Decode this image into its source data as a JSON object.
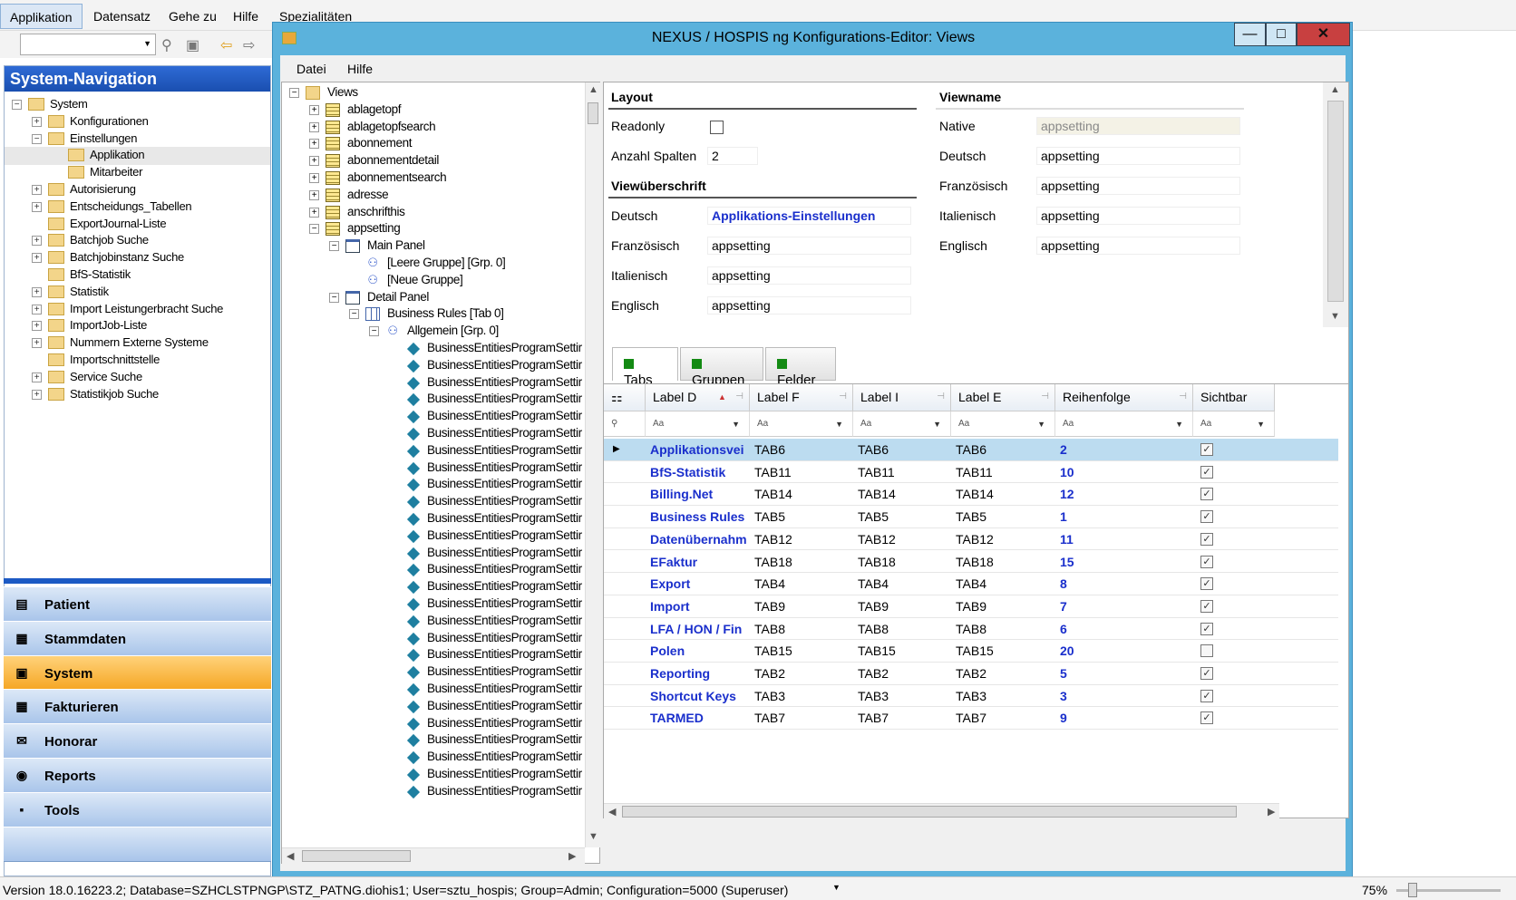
{
  "app": {
    "menu": [
      "Applikation",
      "Datensatz",
      "Gehe zu",
      "Hilfe",
      "Spezialitäten"
    ]
  },
  "sysnav": {
    "title": "System-Navigation",
    "items": [
      {
        "label": "System",
        "level": 0,
        "exp": "−"
      },
      {
        "label": "Konfigurationen",
        "level": 1,
        "exp": "+"
      },
      {
        "label": "Einstellungen",
        "level": 1,
        "exp": "−"
      },
      {
        "label": "Applikation",
        "level": 2,
        "exp": "",
        "selected": true
      },
      {
        "label": "Mitarbeiter",
        "level": 2,
        "exp": ""
      },
      {
        "label": "Autorisierung",
        "level": 1,
        "exp": "+"
      },
      {
        "label": "Entscheidungs_Tabellen",
        "level": 1,
        "exp": "+"
      },
      {
        "label": "ExportJournal-Liste",
        "level": 1,
        "exp": ""
      },
      {
        "label": "Batchjob Suche",
        "level": 1,
        "exp": "+"
      },
      {
        "label": "Batchjobinstanz Suche",
        "level": 1,
        "exp": "+"
      },
      {
        "label": "BfS-Statistik",
        "level": 1,
        "exp": ""
      },
      {
        "label": "Statistik",
        "level": 1,
        "exp": "+"
      },
      {
        "label": "Import Leistungerbracht Suche",
        "level": 1,
        "exp": "+"
      },
      {
        "label": "ImportJob-Liste",
        "level": 1,
        "exp": "+"
      },
      {
        "label": "Nummern Externe Systeme",
        "level": 1,
        "exp": "+"
      },
      {
        "label": "Importschnittstelle",
        "level": 1,
        "exp": ""
      },
      {
        "label": "Service Suche",
        "level": 1,
        "exp": "+"
      },
      {
        "label": "Statistikjob Suche",
        "level": 1,
        "exp": "+"
      }
    ],
    "buttons": [
      {
        "label": "Patient",
        "icon": "patient-icon",
        "glyph": "▤"
      },
      {
        "label": "Stammdaten",
        "icon": "stammdaten-icon",
        "glyph": "▦"
      },
      {
        "label": "System",
        "icon": "system-icon",
        "glyph": "▣",
        "active": true
      },
      {
        "label": "Fakturieren",
        "icon": "fakturieren-icon",
        "glyph": "▦"
      },
      {
        "label": "Honorar",
        "icon": "honorar-icon",
        "glyph": "✉"
      },
      {
        "label": "Reports",
        "icon": "reports-icon",
        "glyph": "◉"
      },
      {
        "label": "Tools",
        "icon": "tools-icon",
        "glyph": "▪"
      }
    ]
  },
  "editor": {
    "title": "NEXUS / HOSPIS ng Konfigurations-Editor: Views",
    "menu": [
      "Datei",
      "Hilfe"
    ],
    "tree": {
      "root": "Views",
      "views": [
        "ablagetopf",
        "ablagetopfsearch",
        "abonnement",
        "abonnementdetail",
        "abonnementsearch",
        "adresse",
        "anschrifthis",
        "appsetting"
      ],
      "main_panel": "Main Panel",
      "main_groups": [
        "[Leere Gruppe] [Grp. 0]",
        "[Neue Gruppe]"
      ],
      "detail_panel": "Detail Panel",
      "business_rules": "Business Rules [Tab 0]",
      "allgemein": "Allgemein [Grp. 0]",
      "leaf": "BusinessEntitiesProgramSettir",
      "leaf_count": 27
    },
    "layout": {
      "section": "Layout",
      "readonly_label": "Readonly",
      "spalten_label": "Anzahl Spalten",
      "spalten_value": "2"
    },
    "ueberschrift": {
      "section": "Viewüberschrift",
      "deutsch_label": "Deutsch",
      "deutsch_value": "Applikations-Einstellungen",
      "franz_label": "Französisch",
      "franz_value": "appsetting",
      "ital_label": "Italienisch",
      "ital_value": "appsetting",
      "engl_label": "Englisch",
      "engl_value": "appsetting"
    },
    "viewname": {
      "section": "Viewname",
      "native_label": "Native",
      "native_value": "appsetting",
      "deutsch_label": "Deutsch",
      "deutsch_value": "appsetting",
      "franz_label": "Französisch",
      "franz_value": "appsetting",
      "ital_label": "Italienisch",
      "ital_value": "appsetting",
      "engl_label": "Englisch",
      "engl_value": "appsetting"
    },
    "tabs": [
      "Tabs",
      "Gruppen",
      "Felder"
    ],
    "grid": {
      "columns": [
        "Label D",
        "Label F",
        "Label I",
        "Label E",
        "Reihenfolge",
        "Sichtbar"
      ],
      "filter_glyph": "Aa",
      "rows": [
        {
          "d": "Applikationsvei",
          "f": "TAB6",
          "i": "TAB6",
          "e": "TAB6",
          "r": "2",
          "v": true
        },
        {
          "d": "BfS-Statistik",
          "f": "TAB11",
          "i": "TAB11",
          "e": "TAB11",
          "r": "10",
          "v": true
        },
        {
          "d": "Billing.Net",
          "f": "TAB14",
          "i": "TAB14",
          "e": "TAB14",
          "r": "12",
          "v": true
        },
        {
          "d": "Business Rules",
          "f": "TAB5",
          "i": "TAB5",
          "e": "TAB5",
          "r": "1",
          "v": true
        },
        {
          "d": "Datenübernahm",
          "f": "TAB12",
          "i": "TAB12",
          "e": "TAB12",
          "r": "11",
          "v": true
        },
        {
          "d": "EFaktur",
          "f": "TAB18",
          "i": "TAB18",
          "e": "TAB18",
          "r": "15",
          "v": true
        },
        {
          "d": "Export",
          "f": "TAB4",
          "i": "TAB4",
          "e": "TAB4",
          "r": "8",
          "v": true
        },
        {
          "d": "Import",
          "f": "TAB9",
          "i": "TAB9",
          "e": "TAB9",
          "r": "7",
          "v": true
        },
        {
          "d": "LFA / HON / Fin",
          "f": "TAB8",
          "i": "TAB8",
          "e": "TAB8",
          "r": "6",
          "v": true
        },
        {
          "d": "Polen",
          "f": "TAB15",
          "i": "TAB15",
          "e": "TAB15",
          "r": "20",
          "v": false
        },
        {
          "d": "Reporting",
          "f": "TAB2",
          "i": "TAB2",
          "e": "TAB2",
          "r": "5",
          "v": true
        },
        {
          "d": "Shortcut Keys",
          "f": "TAB3",
          "i": "TAB3",
          "e": "TAB3",
          "r": "3",
          "v": true
        },
        {
          "d": "TARMED",
          "f": "TAB7",
          "i": "TAB7",
          "e": "TAB7",
          "r": "9",
          "v": true
        }
      ]
    }
  },
  "status": {
    "text": "Version 18.0.16223.2; Database=SZHCLSTPNGP\\STZ_PATNG.diohis1; User=sztu_hospis; Group=Admin; Configuration=5000 (Superuser)",
    "zoom": "75%"
  }
}
